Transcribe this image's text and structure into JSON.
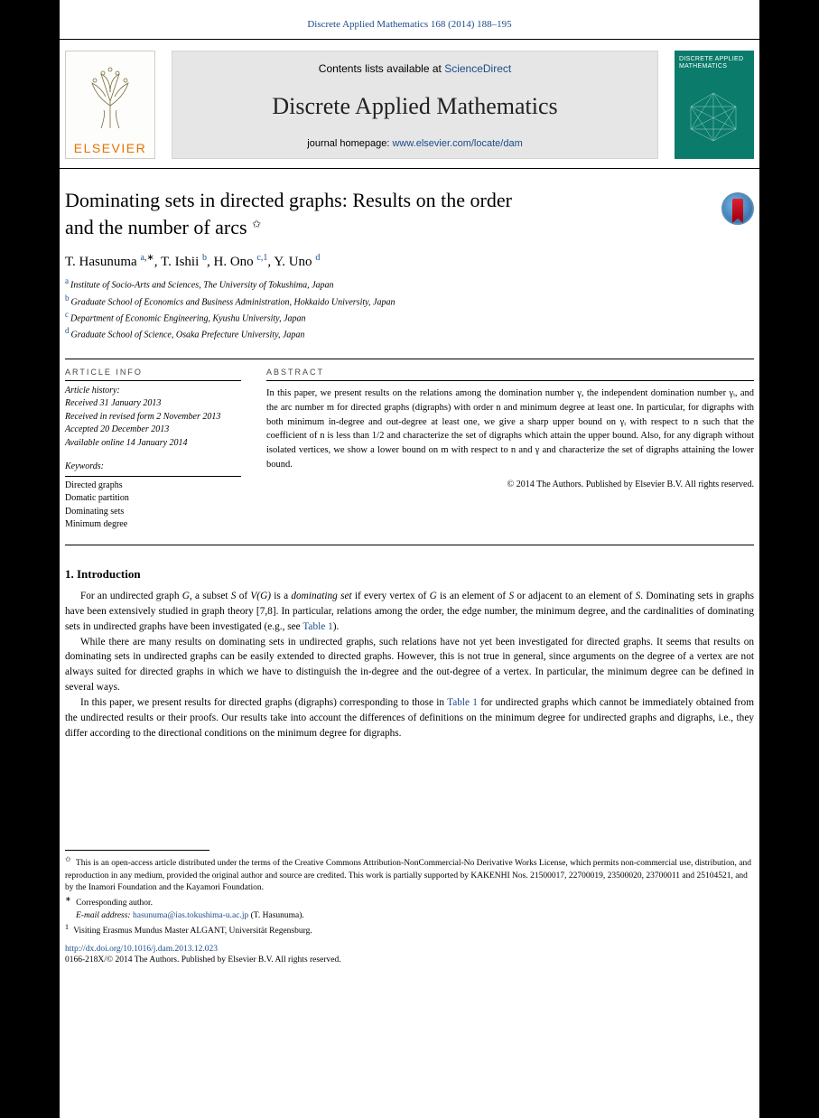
{
  "citation": "Discrete Applied Mathematics 168 (2014) 188–195",
  "banner": {
    "elsevier": "ELSEVIER",
    "contents_prefix": "Contents lists available at ",
    "contents_link": "ScienceDirect",
    "journal_title": "Discrete Applied Mathematics",
    "homepage_prefix": "journal homepage: ",
    "homepage_link": "www.elsevier.com/locate/dam",
    "cover_title": "DISCRETE APPLIED MATHEMATICS"
  },
  "paper": {
    "title_line1": "Dominating sets in directed graphs: Results on the order",
    "title_line2": "and the number of arcs ",
    "title_note_mark": "✩",
    "authors": {
      "a1": {
        "name": "T. Hasunuma ",
        "aff": "a",
        "corr": ",∗"
      },
      "a2": {
        "name": ", T. Ishii ",
        "aff": "b"
      },
      "a3": {
        "name": ", H. Ono ",
        "aff": "c,1"
      },
      "a4": {
        "name": ", Y. Uno ",
        "aff": "d"
      }
    },
    "affiliations": {
      "a": "Institute of Socio-Arts and Sciences, The University of Tokushima, Japan",
      "b": "Graduate School of Economics and Business Administration, Hokkaido University, Japan",
      "c": "Department of Economic Engineering, Kyushu University, Japan",
      "d": "Graduate School of Science, Osaka Prefecture University, Japan"
    }
  },
  "info": {
    "header": "ARTICLE INFO",
    "history": {
      "h1": "Article history:",
      "h2": "Received 31 January 2013",
      "h3": "Received in revised form 2 November 2013",
      "h4": "Accepted 20 December 2013",
      "h5": "Available online 14 January 2014"
    },
    "kw_header": "Keywords:",
    "keywords": [
      "Directed graphs",
      "Domatic partition",
      "Dominating sets",
      "Minimum degree"
    ]
  },
  "abstract": {
    "header": "ABSTRACT",
    "text": "In this paper, we present results on the relations among the domination number γ, the independent domination number γᵢ, and the arc number m for directed graphs (digraphs) with order n and minimum degree at least one. In particular, for digraphs with both minimum in-degree and out-degree at least one, we give a sharp upper bound on γᵢ with respect to n such that the coefficient of n is less than 1/2 and characterize the set of digraphs which attain the upper bound. Also, for any digraph without isolated vertices, we show a lower bound on m with respect to n and γ and characterize the set of digraphs attaining the lower bound.",
    "copyright": "© 2014 The Authors. Published by Elsevier B.V. All rights reserved."
  },
  "section1": {
    "heading": "1. Introduction",
    "p1_a": "For an undirected graph ",
    "p1_b": ", a subset ",
    "p1_c": " of ",
    "p1_d": " is a ",
    "p1_term": "dominating set",
    "p1_e": " if every vertex of ",
    "p1_f": " is an element of ",
    "p1_g": " or adjacent to an element of ",
    "p1_h": ". Dominating sets in graphs have been extensively studied in graph theory [7,8]. In particular, relations among the order, the edge number, the minimum degree, and the cardinalities of dominating sets in undirected graphs have been investigated (e.g., see ",
    "p1_table": "Table 1",
    "p1_i": ").",
    "p2_a": "While there are many results on dominating sets in undirected graphs, such relations have not yet been investigated for directed graphs. It seems that results on dominating sets in undirected graphs can be easily extended to directed graphs. However, this is not true in general, since arguments on the degree of a vertex are not always suited for directed graphs in which we have to distinguish the in-degree and the out-degree of a vertex. In particular, the minimum degree can be defined in several ways.",
    "p3_a": "In this paper, we present results for directed graphs (digraphs) corresponding to those in ",
    "p3_table": "Table 1",
    "p3_b": " for undirected graphs which cannot be immediately obtained from the undirected results or their proofs. Our results take into account the differences of definitions on the minimum degree for undirected graphs and digraphs, i.e., they differ according to the directional conditions on the minimum degree for digraphs."
  },
  "footnotes": {
    "note_mark": "✩",
    "note_text": " This is an open-access article distributed under the terms of the Creative Commons Attribution-NonCommercial-No Derivative Works License, which permits non-commercial use, distribution, and reproduction in any medium, provided the original author and source are credited. This work is partially supported by KAKENHI Nos. 21500017, 22700019, 23500020, 23700011 and 25104521, and by the Inamori Foundation and the Kayamori Foundation.",
    "corr_mark": "∗",
    "corr_text": " Corresponding author.",
    "email_label": "E-mail address: ",
    "email": "hasunuma@ias.tokushima-u.ac.jp",
    "email_who": " (T. Hasunuma).",
    "visit_mark": "1",
    "visit_text": " Visiting Erasmus Mundus Master ALGANT, Universität Regensburg."
  },
  "doi": {
    "link": "http://dx.doi.org/10.1016/j.dam.2013.12.023",
    "line2": "0166-218X/© 2014 The Authors. Published by Elsevier B.V. All rights reserved."
  }
}
